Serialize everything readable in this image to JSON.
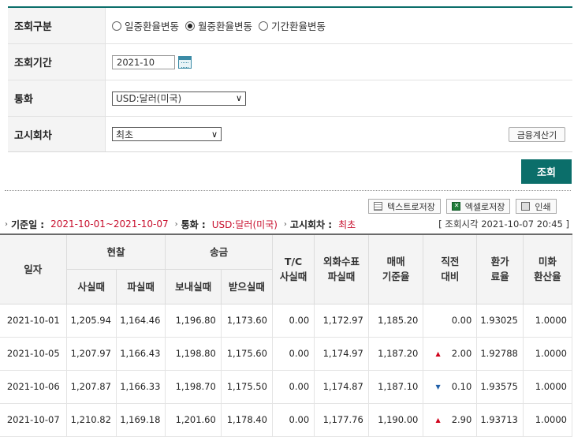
{
  "form": {
    "type_label": "조회구분",
    "radios": [
      "일중환율변동",
      "월중환율변동",
      "기간환율변동"
    ],
    "selected_radio": 1,
    "period_label": "조회기간",
    "period_value": "2021-10",
    "currency_label": "통화",
    "currency_value": "USD:달러(미국)",
    "notice_label": "고시회차",
    "notice_value": "최초",
    "calc_button": "금융계산기"
  },
  "search_button": "조회",
  "tools": {
    "text_save": "텍스트로저장",
    "excel_save": "엑셀로저장",
    "print": "인쇄"
  },
  "info": {
    "date_label": "기준일 :",
    "date_value": "2021-10-01~2021-10-07",
    "currency_label": "통화 :",
    "currency_value": "USD:달러(미국)",
    "notice_label": "고시회차 :",
    "notice_value": "최초",
    "query_time": "[ 조회시각 2021-10-07 20:45 ]"
  },
  "table": {
    "headers": {
      "date": "일자",
      "cash": "현찰",
      "remit": "송금",
      "cash_buy": "사실때",
      "cash_sell": "파실때",
      "remit_send": "보내실때",
      "remit_recv": "받으실때",
      "tc": [
        "T/C",
        "사실때"
      ],
      "check": [
        "외화수표",
        "파실때"
      ],
      "base": [
        "매매",
        "기준율"
      ],
      "prev": [
        "직전",
        "대비"
      ],
      "conv": [
        "환가",
        "료율"
      ],
      "usd": [
        "미화",
        "환산율"
      ]
    },
    "rows": [
      [
        "2021-10-01",
        "1,205.94",
        "1,164.46",
        "1,196.80",
        "1,173.60",
        "0.00",
        "1,172.97",
        "1,185.20",
        "",
        "0.00",
        "1.93025",
        "1.0000"
      ],
      [
        "2021-10-05",
        "1,207.97",
        "1,166.43",
        "1,198.80",
        "1,175.60",
        "0.00",
        "1,174.97",
        "1,187.20",
        "up",
        "2.00",
        "1.92788",
        "1.0000"
      ],
      [
        "2021-10-06",
        "1,207.87",
        "1,166.33",
        "1,198.70",
        "1,175.50",
        "0.00",
        "1,174.87",
        "1,187.10",
        "down",
        "0.10",
        "1.93575",
        "1.0000"
      ],
      [
        "2021-10-07",
        "1,210.82",
        "1,169.18",
        "1,201.60",
        "1,178.40",
        "0.00",
        "1,177.76",
        "1,190.00",
        "up",
        "2.90",
        "1.93713",
        "1.0000"
      ]
    ]
  }
}
